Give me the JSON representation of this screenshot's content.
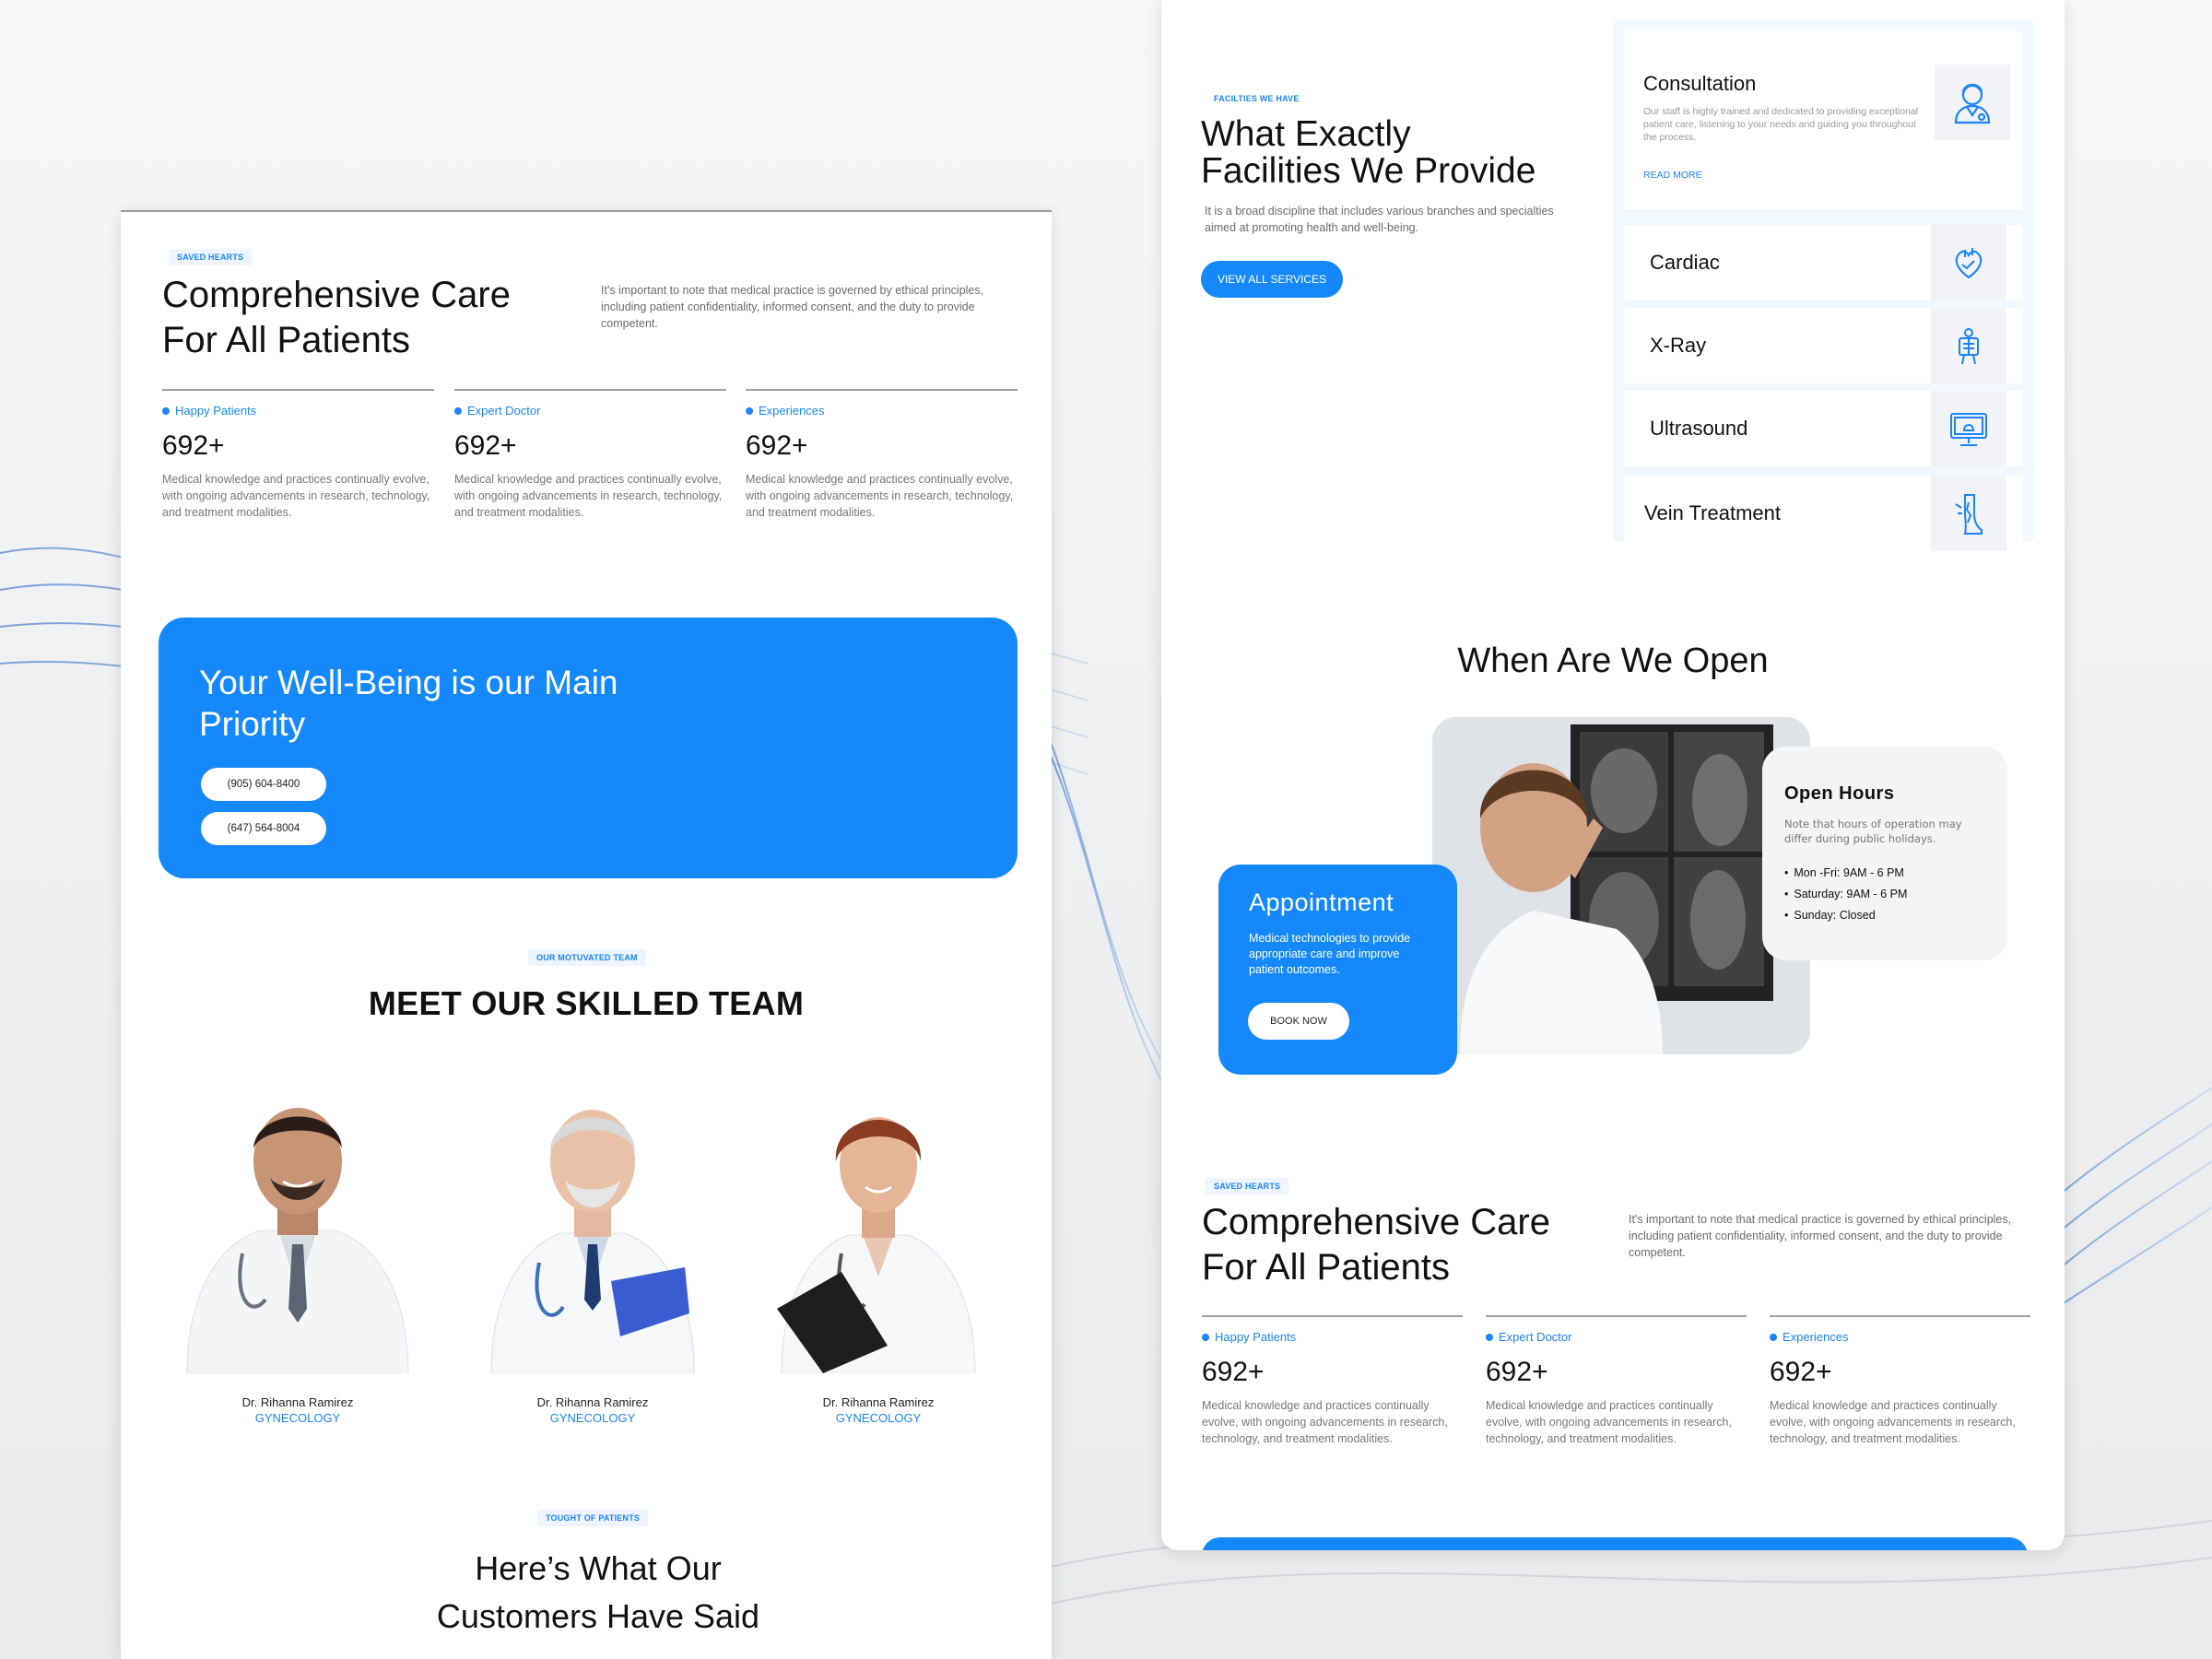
{
  "left": {
    "care": {
      "tag": "SAVED HEARTS",
      "title_line1": "Comprehensive Care",
      "title_line2": "For All Patients",
      "text": "It's important to note that medical practice is governed by ethical principles, including patient confidentiality, informed consent, and the duty to provide competent."
    },
    "stats": [
      {
        "label": "Happy Patients",
        "value": "692+",
        "desc": "Medical knowledge and practices continually evolve, with ongoing advancements in research, technology, and treatment modalities."
      },
      {
        "label": "Expert Doctor",
        "value": "692+",
        "desc": "Medical knowledge and practices continually evolve, with ongoing advancements in research, technology, and treatment modalities."
      },
      {
        "label": "Experiences",
        "value": "692+",
        "desc": "Medical knowledge and practices continually evolve, with ongoing advancements in research, technology, and treatment modalities."
      }
    ],
    "banner": {
      "title": "Your Well-Being is our Main Priority",
      "phone1": "(905) 604-8400",
      "phone2": "(647) 564-8004"
    },
    "team": {
      "tag": "OUR MOTUVATED TEAM",
      "title": "MEET OUR SKILLED TEAM",
      "doctors": [
        {
          "name": "Dr. Rihanna Ramirez",
          "specialty": "GYNECOLOGY"
        },
        {
          "name": "Dr. Rihanna Ramirez",
          "specialty": "GYNECOLOGY"
        },
        {
          "name": "Dr. Rihanna Ramirez",
          "specialty": "GYNECOLOGY"
        }
      ]
    },
    "testimonials": {
      "tag": "TOUGHT OF PATIENTS",
      "title_line1": "Here’s What Our",
      "title_line2": "Customers Have Said"
    }
  },
  "right": {
    "facilities": {
      "tag": "FACILTIES WE HAVE",
      "title_line1": "What Exactly",
      "title_line2": "Facilities We Provide",
      "text": "It is a broad discipline that includes various branches and specialties aimed at promoting health and well-being.",
      "button": "VIEW ALL SERVICES"
    },
    "services": {
      "featured": {
        "title": "Consultation",
        "text": "Our staff is highly trained and dedicated to providing exceptional patient care, listening to your needs and guiding you throughout the process.",
        "link": "READ MORE",
        "icon": "doctor-icon"
      },
      "items": [
        {
          "name": "Cardiac",
          "icon": "heart-icon"
        },
        {
          "name": "X-Ray",
          "icon": "xray-icon"
        },
        {
          "name": "Ultrasound",
          "icon": "monitor-icon"
        },
        {
          "name": "Vein Treatment",
          "icon": "leg-icon"
        }
      ]
    },
    "open": {
      "title": "When Are We Open",
      "hours_title": "Open Hours",
      "hours_note": "Note that hours of operation may differ during public holidays.",
      "hours": [
        "Mon -Fri: 9AM - 6 PM",
        "Saturday: 9AM - 6 PM",
        "Sunday: Closed"
      ],
      "appointment_title": "Appointment",
      "appointment_text": "Medical technologies to provide appropriate care and improve patient outcomes.",
      "appointment_button": "BOOK NOW"
    },
    "care": {
      "tag": "SAVED HEARTS",
      "title_line1": "Comprehensive Care",
      "title_line2": "For All Patients",
      "text": "It's important to note that medical practice is governed by ethical principles, including patient confidentiality, informed consent, and the duty to provide competent."
    },
    "stats": [
      {
        "label": "Happy Patients",
        "value": "692+",
        "desc": "Medical knowledge and practices continually evolve, with ongoing advancements in research, technology, and treatment modalities."
      },
      {
        "label": "Expert Doctor",
        "value": "692+",
        "desc": "Medical knowledge and practices continually evolve, with ongoing advancements in research, technology, and treatment modalities."
      },
      {
        "label": "Experiences",
        "value": "692+",
        "desc": "Medical knowledge and practices continually evolve, with ongoing advancements in research, technology, and treatment modalities."
      }
    ]
  },
  "colors": {
    "accent": "#1589fb",
    "tag_bg": "#eef5ff",
    "text": "#111111",
    "muted": "#777777"
  }
}
